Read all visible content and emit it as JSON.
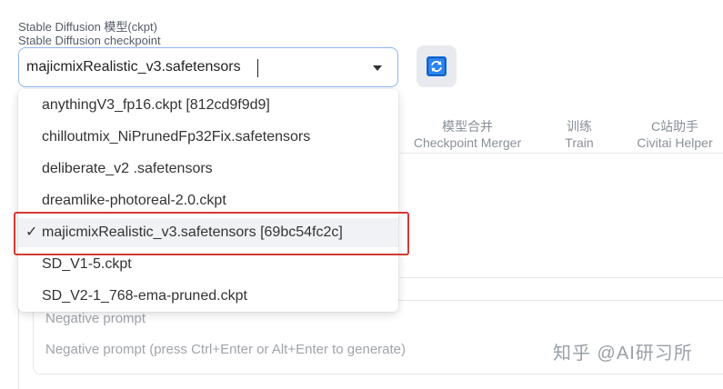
{
  "model": {
    "label_cn": "Stable Diffusion 模型(ckpt)",
    "label_en": "Stable Diffusion checkpoint",
    "selected_value": "majicmixRealistic_v3.safetensors",
    "refresh_icon": "refresh-icon"
  },
  "tabs": [
    {
      "cn": "模型合并",
      "en": "Checkpoint Merger"
    },
    {
      "cn": "训练",
      "en": "Train"
    },
    {
      "cn": "C站助手",
      "en": "Civitai Helper"
    }
  ],
  "dropdown": {
    "items": [
      {
        "label": "anythingV3_fp16.ckpt [812cd9f9d9]"
      },
      {
        "label": "chilloutmix_NiPrunedFp32Fix.safetensors"
      },
      {
        "label": "deliberate_v2 .safetensors"
      },
      {
        "label": "dreamlike-photoreal-2.0.ckpt"
      },
      {
        "label": "majicmixRealistic_v3.safetensors [69bc54fc2c]"
      },
      {
        "label": "SD_V1-5.ckpt"
      },
      {
        "label": "SD_V2-1_768-ema-pruned.ckpt"
      }
    ],
    "selected_index": 4,
    "check": "✓"
  },
  "negative_prompt": {
    "label": "Negative prompt",
    "placeholder": "Negative prompt (press Ctrl+Enter or Alt+Enter to generate)"
  },
  "watermark": "知乎 @AI研习所",
  "colors": {
    "accent": "#1a73e8",
    "highlight": "#d23a34"
  }
}
